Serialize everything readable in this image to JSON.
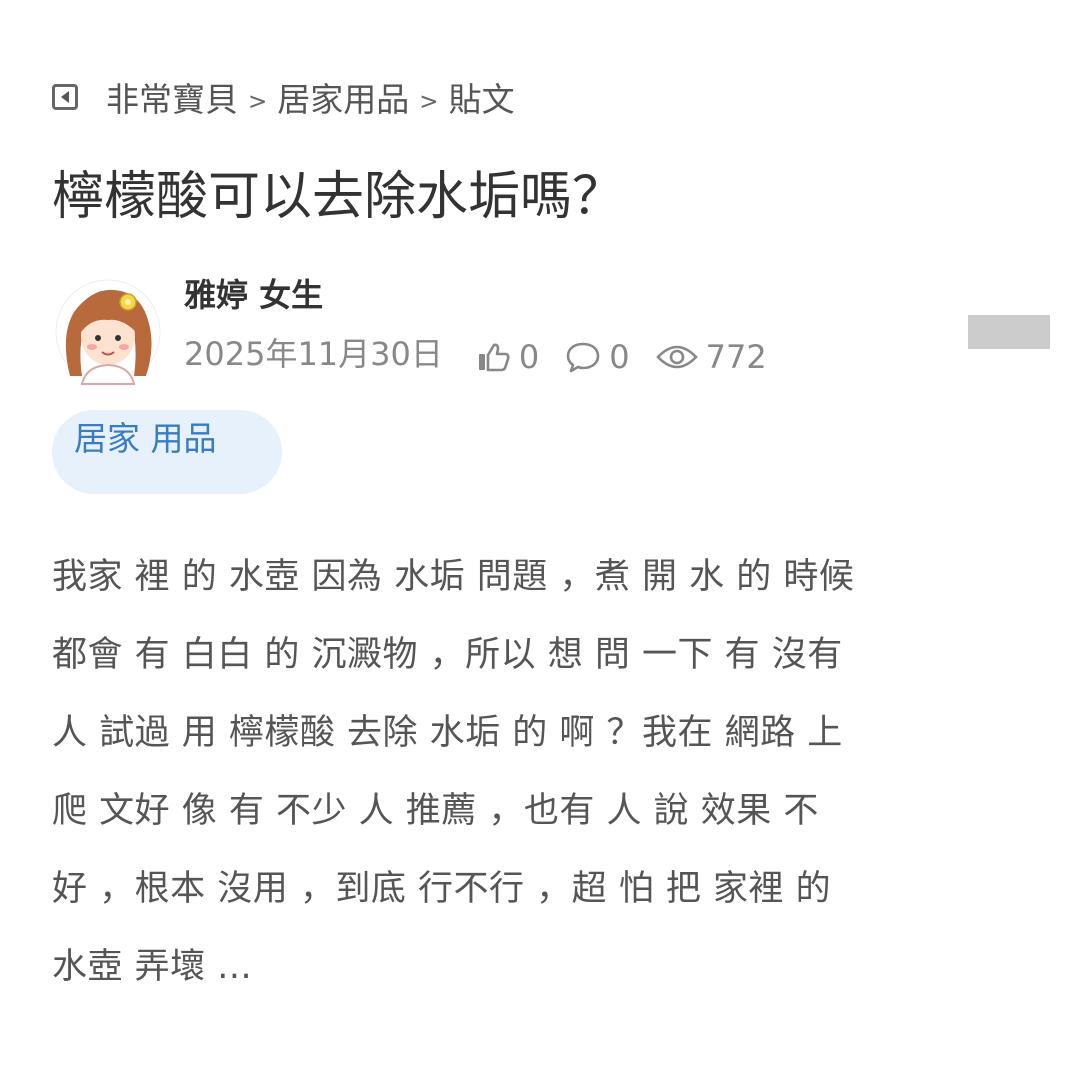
{
  "breadcrumb": {
    "items": [
      "非常寶貝",
      "居家用品",
      "貼文"
    ],
    "separator": ">"
  },
  "post": {
    "title": "檸檬酸可以去除水垢嗎？",
    "author": "雅婷 女生",
    "date": "2025年11月30日",
    "likes": "0",
    "comments": "0",
    "views": "772",
    "tag": "居家  用品",
    "content_lines": [
      "我家 裡 的 水壺 因為 水垢 問題 ，煮 開 水 的 時候",
      "都會 有 白白 的 沉澱物  ，所以 想 問 一下 有 沒有",
      "人 試過 用 檸檬酸  去除 水垢 的 啊 ？我在 網路 上",
      "爬 文好 像 有 不少 人 推薦 ，也有 人 說 效果 不",
      "好 ，根本 沒用 ，到底 行不行  ，超 怕 把 家裡 的",
      "水壺 弄壞 ..."
    ]
  },
  "icons": {
    "back": "back-square-icon",
    "like": "thumbs-up-icon",
    "comment": "comment-bubble-icon",
    "view": "eye-icon"
  },
  "colors": {
    "tag_bg": "#e6f1fc",
    "tag_text": "#3a7cc0",
    "meta_text": "#888888",
    "title_text": "#333333"
  }
}
